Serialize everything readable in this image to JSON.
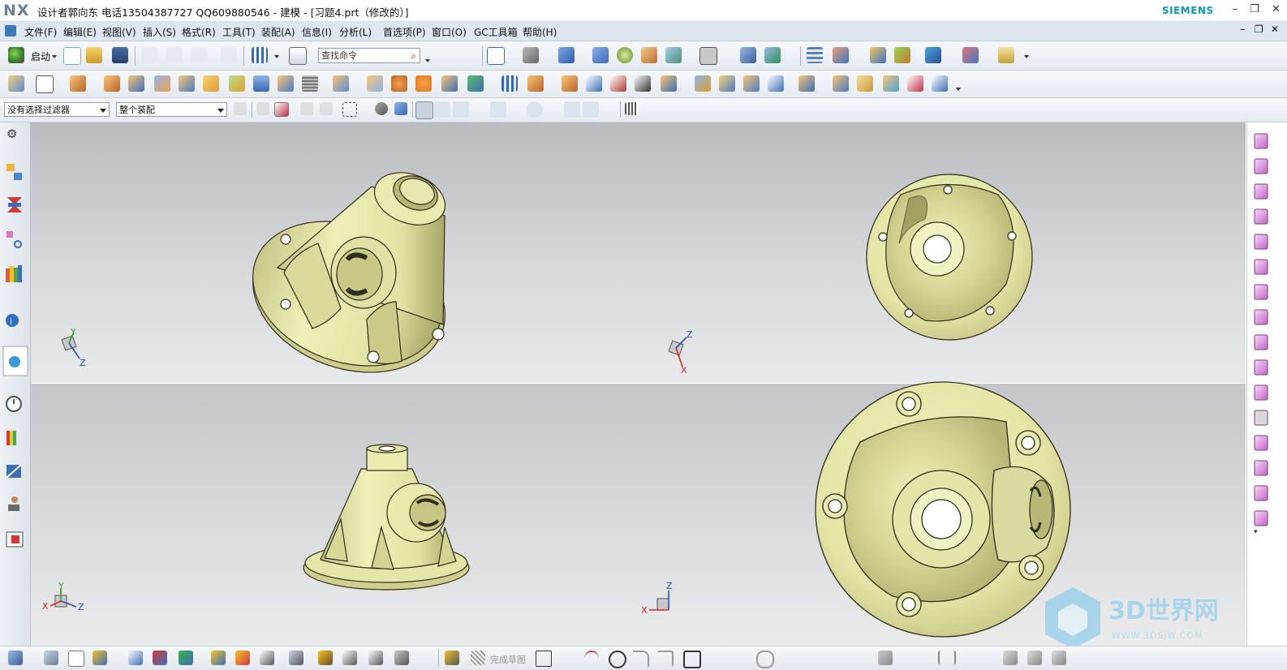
{
  "app": {
    "logo": "NX",
    "window_title": "设计者郭向东  电话13504387727  QQ609880546 - 建模 - [习题4.prt（修改的）]",
    "brand": "SIEMENS"
  },
  "menu": [
    "文件(F)",
    "编辑(E)",
    "视图(V)",
    "插入(S)",
    "格式(R)",
    "工具(T)",
    "装配(A)",
    "信息(I)",
    "分析(L)",
    "首选项(P)",
    "窗口(O)",
    "GC工具箱",
    "帮助(H)"
  ],
  "toolbar1": {
    "start_label": "启动",
    "search_placeholder": "查找命令"
  },
  "selection": {
    "filter_value": "没有选择过滤器",
    "scope_value": "整个装配"
  },
  "viewports": {
    "top_left": {
      "triad": [
        "Y",
        "Z"
      ]
    },
    "top_right": {
      "triad": [
        "Z",
        "X"
      ]
    },
    "bottom_left": {
      "triad": [
        "Y",
        "X",
        "Z"
      ]
    },
    "bottom_right": {
      "triad": [
        "Z",
        "X"
      ]
    }
  },
  "bottom_toolbar": {
    "finish_sketch_label": "完成草图"
  },
  "watermark": {
    "text": "3D世界网",
    "url": "WWW.3DSJW.COM"
  },
  "colors": {
    "part_face": "#e6e6a6",
    "part_shadow": "#9c9c58",
    "menu_bg": "#dde6f1",
    "brand": "#0d9ab2"
  },
  "icons": {
    "left": [
      "gear-icon",
      "assembly-navigator-icon",
      "constraint-navigator-icon",
      "part-navigator-icon",
      "reuse-library-icon",
      "info-icon",
      "web-browser-icon",
      "history-icon",
      "system-materials-icon",
      "process-studio-icon",
      "manikin-icon",
      "roles-icon"
    ]
  }
}
